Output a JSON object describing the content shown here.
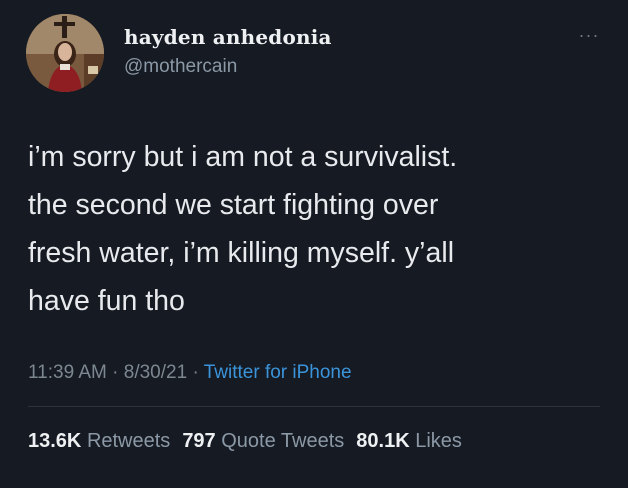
{
  "author": {
    "display_name": "hayden anhedonia",
    "handle": "@mothercain",
    "avatar_icon": "profile-photo"
  },
  "menu": {
    "more_glyph": "···",
    "icon": "more-horizontal-icon"
  },
  "tweet": {
    "text": "i’m sorry but i am not a survivalist.\nthe second we start fighting over\nfresh water, i’m killing myself. y’all\nhave fun tho"
  },
  "meta": {
    "time": "11:39 AM",
    "sep1": " · ",
    "date": "8/30/21",
    "sep2": " · ",
    "source": "Twitter for iPhone"
  },
  "stats": {
    "retweets_count": "13.6K",
    "retweets_label": "Retweets",
    "quotes_count": "797",
    "quotes_label": "Quote Tweets",
    "likes_count": "80.1K",
    "likes_label": "Likes"
  },
  "colors": {
    "background": "#151a23",
    "text": "#e8eaed",
    "secondary": "#8b98a5",
    "link": "#3b94d9"
  }
}
